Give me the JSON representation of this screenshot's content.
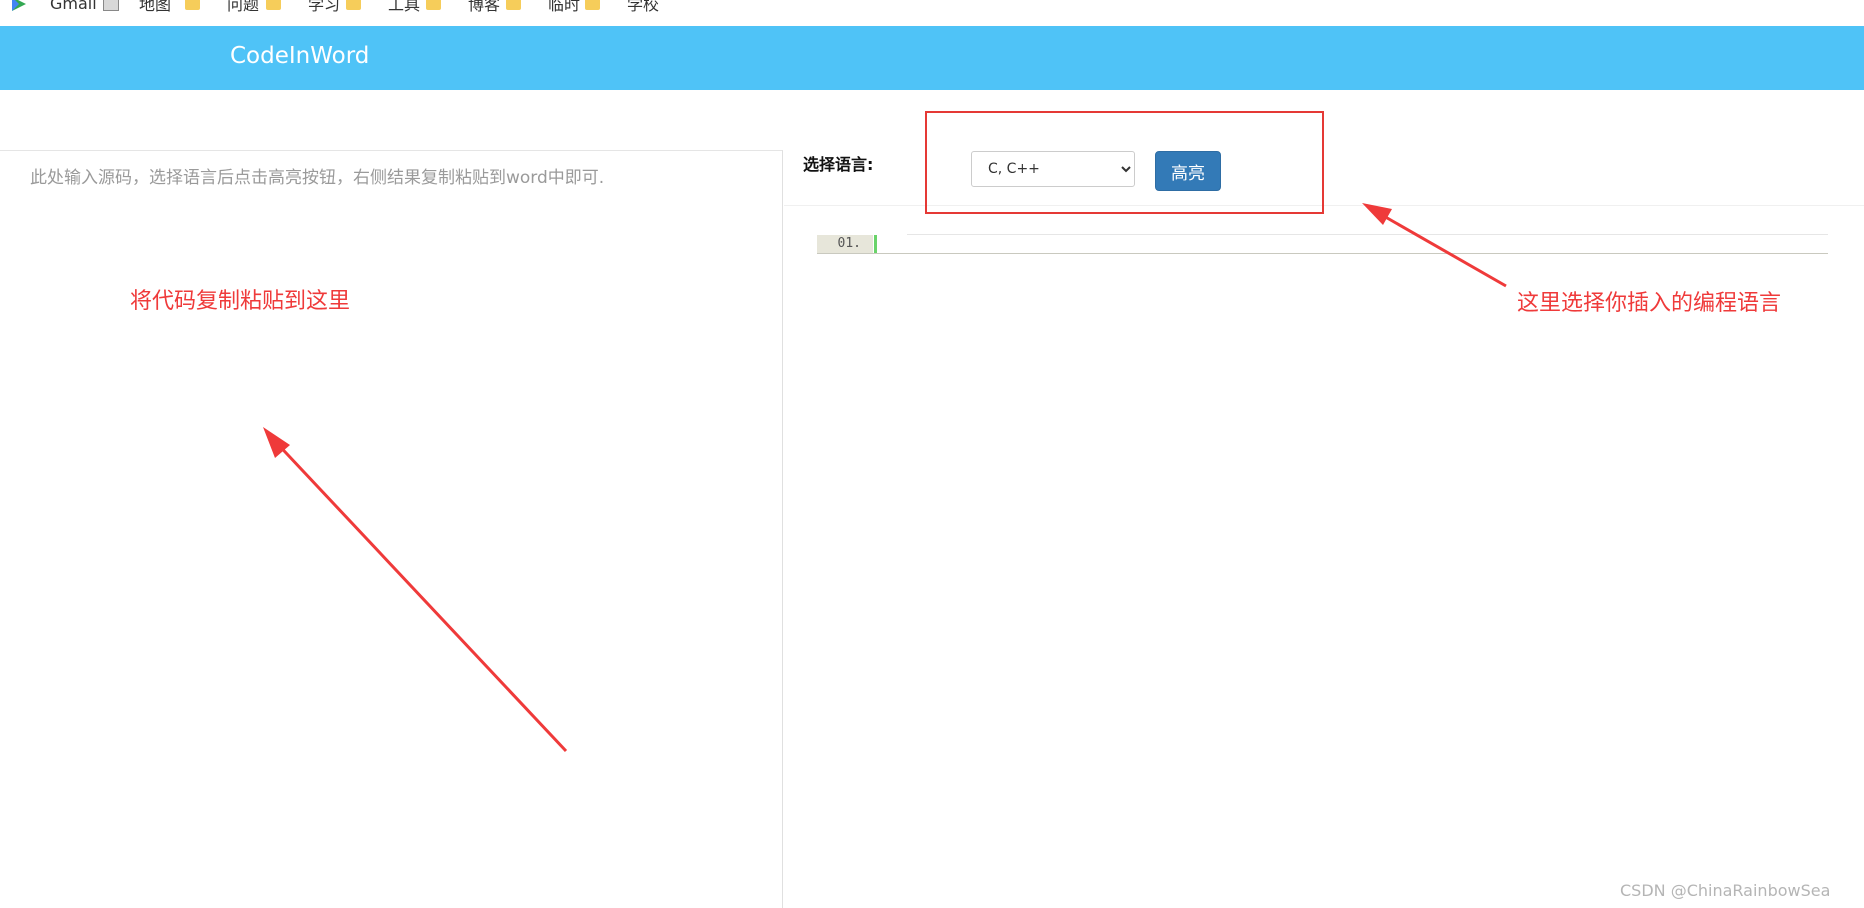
{
  "bookmarks": [
    {
      "label": "Gmail",
      "icon": "play-icon"
    },
    {
      "label": "地图",
      "icon": "map-icon"
    },
    {
      "label": "问题",
      "icon": "folder-icon"
    },
    {
      "label": "学习",
      "icon": "folder-icon"
    },
    {
      "label": "工具",
      "icon": "folder-icon"
    },
    {
      "label": "博客",
      "icon": "folder-icon"
    },
    {
      "label": "临时",
      "icon": "folder-icon"
    },
    {
      "label": "学校",
      "icon": "folder-icon"
    }
  ],
  "navbar": {
    "brand": "CodeInWord",
    "color": "#4fc3f7"
  },
  "editor": {
    "placeholder": "此处输入源码，选择语言后点击高亮按钮，右侧结果复制粘贴到word中即可."
  },
  "toolbar": {
    "language_label": "选择语言:",
    "language_selected": "C, C++",
    "highlight_label": "高亮",
    "button_color": "#337ab7"
  },
  "output": {
    "line_number": "01."
  },
  "annotations": {
    "left_text": "将代码复制粘贴到这里",
    "right_text": "这里选择你插入的编程语言",
    "color": "#ef3a3a"
  },
  "watermark": "CSDN @ChinaRainbowSea"
}
